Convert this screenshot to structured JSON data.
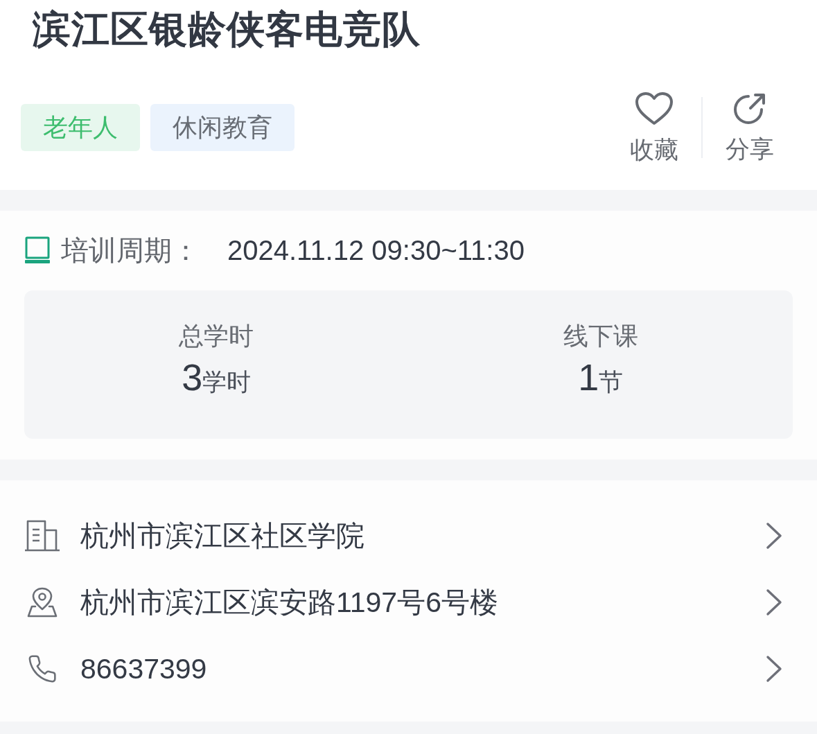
{
  "title": "滨江区银龄侠客电竞队",
  "tags": [
    {
      "label": "老年人",
      "kind": "audience"
    },
    {
      "label": "休闲教育",
      "kind": "category"
    }
  ],
  "actions": [
    {
      "label": "收藏",
      "kind": "favorite"
    },
    {
      "label": "分享",
      "kind": "share"
    }
  ],
  "period": {
    "label": "培训周期：",
    "value": "2024.11.12 09:30~11:30"
  },
  "stats": [
    {
      "label": "总学时",
      "value": "3",
      "unit": "学时"
    },
    {
      "label": "线下课",
      "value": "1",
      "unit": "节"
    }
  ],
  "contacts": [
    {
      "kind": "institution",
      "text": "杭州市滨江区社区学院"
    },
    {
      "kind": "address",
      "text": "杭州市滨江区滨安路1197号6号楼"
    },
    {
      "kind": "phone",
      "text": "86637399"
    }
  ]
}
